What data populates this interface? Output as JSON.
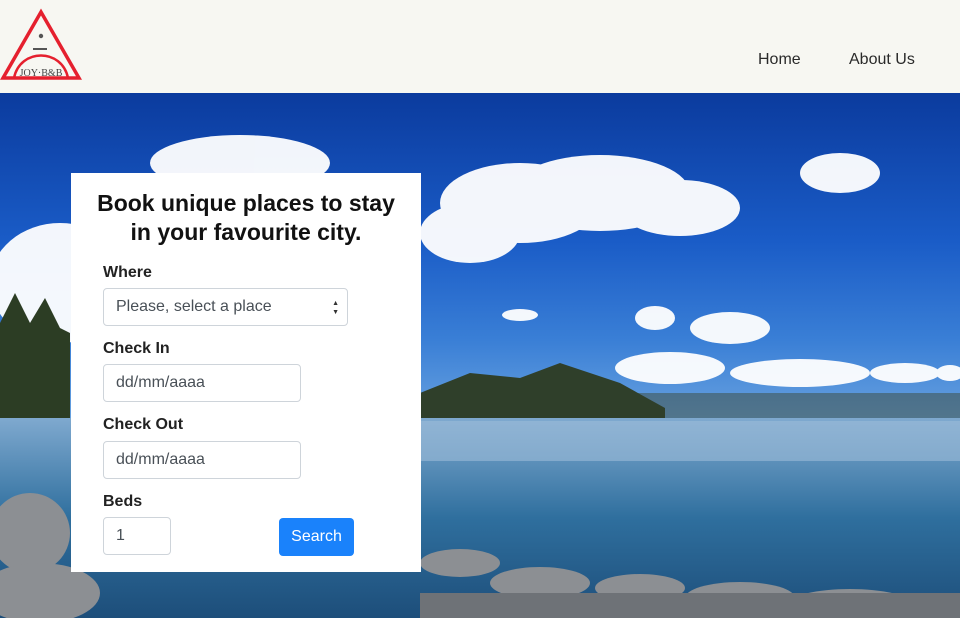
{
  "header": {
    "logo_text": "JOY·B&B",
    "nav": [
      {
        "label": "Home"
      },
      {
        "label": "About Us"
      }
    ]
  },
  "booking": {
    "title_line1": "Book unique places to stay",
    "title_line2": "in your favourite city.",
    "where_label": "Where",
    "where_value": "Please, select a place",
    "checkin_label": "Check In",
    "checkin_value": "dd/mm/aaaa",
    "checkout_label": "Check Out",
    "checkout_value": "dd/mm/aaaa",
    "beds_label": "Beds",
    "beds_value": "1",
    "search_label": "Search"
  },
  "colors": {
    "brand_red": "#e5202e",
    "primary_button": "#1a82fb",
    "header_bg": "#f7f7f2"
  },
  "icons": [
    "logo-icon",
    "select-arrows-icon"
  ]
}
